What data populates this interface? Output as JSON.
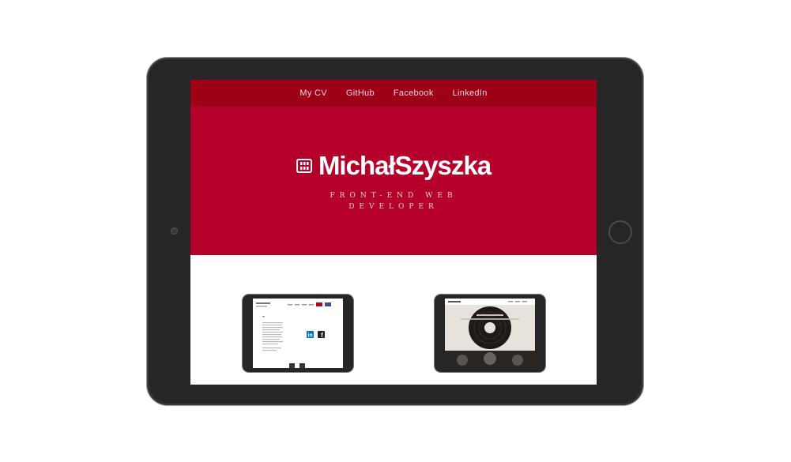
{
  "nav": {
    "items": [
      {
        "label": "My CV"
      },
      {
        "label": "GitHub"
      },
      {
        "label": "Facebook"
      },
      {
        "label": "LinkedIn"
      }
    ]
  },
  "hero": {
    "brand_name": "MichałSzyszka",
    "tagline_line1": "FRONT-END WEB",
    "tagline_line2": "DEVELOPER",
    "logo_icon": "logo-monogram-icon"
  },
  "colors": {
    "nav_bg": "#9e0018",
    "hero_bg": "#b4002b",
    "device_frame": "#262626"
  },
  "portfolio": {
    "items": [
      {
        "icon": "tablet-preview-cv-site"
      },
      {
        "icon": "tablet-preview-vinyl-site"
      }
    ]
  }
}
